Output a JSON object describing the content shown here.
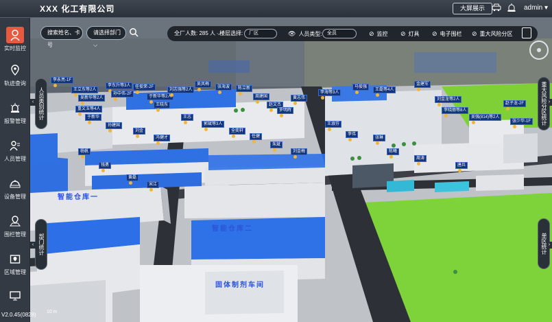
{
  "company": "XXX 化工有限公司",
  "topbar": {
    "big_screen_label": "大屏展示",
    "user_name": "admin",
    "user_caret": "▾"
  },
  "sidebar": {
    "items": [
      {
        "label": "实时监控",
        "icon": "monitor-icon"
      },
      {
        "label": "轨迹查询",
        "icon": "track-icon"
      },
      {
        "label": "报警管理",
        "icon": "alarm-icon"
      },
      {
        "label": "人员管理",
        "icon": "person-icon"
      },
      {
        "label": "设备管理",
        "icon": "device-icon"
      },
      {
        "label": "围栏管理",
        "icon": "fence-icon"
      },
      {
        "label": "区域管理",
        "icon": "area-icon"
      },
      {
        "label": "",
        "icon": "screen-icon"
      }
    ],
    "version": "V2.0.45(0828)"
  },
  "search": {
    "name_placeholder": "搜索姓名、卡号",
    "dept_placeholder": "请选择部门",
    "dept_caret": "⌵"
  },
  "toolbar": {
    "total_label": "全厂人数: 285 人",
    "total_caret": "⌵",
    "floor_label": "楼层选择:",
    "floor_value": "厂区",
    "type_label": "人员类型:",
    "type_value": "全员",
    "toggles": [
      "监控",
      "灯具",
      "电子围栏",
      "重大风险分区"
    ]
  },
  "side_tabs": {
    "left_top": "人员类别统计",
    "left_bottom": "部门统计",
    "right_top": "重大风险分区统计",
    "right_bottom": "单区统计"
  },
  "map": {
    "buildings": [
      "智能仓库一",
      "智能仓库二",
      "固体制剂车间"
    ],
    "tags": [
      "李永亮-1F",
      "王立东等2人",
      "吴新华等2人",
      "重文玉等4人",
      "李东升等3人",
      "孙中伟-2F",
      "任俊荣-2F",
      "于新华等2人",
      "王晓东",
      "刘志强等2人",
      "吴凤梅",
      "张海波",
      "陈立新",
      "周建国",
      "赵文杰",
      "罗明辉",
      "黄志伟",
      "李海等3人",
      "马俊强",
      "王磊等4人",
      "金建军",
      "刘金龙等2人",
      "李晓丽等8人",
      "吴强(814)等2人",
      "赵子龙-2F",
      "张少华-1F",
      "于新华",
      "孙建国",
      "刘金",
      "冯健才",
      "王志",
      "郭斌等3人",
      "全奕轩",
      "任健",
      "朱斌",
      "刘金梅",
      "王淑芬",
      "李伟",
      "张琳",
      "陈曦",
      "周涛",
      "唐兵",
      "杨帆",
      "钱勇",
      "黄磊",
      "宋江"
    ],
    "scale": "10 m"
  }
}
